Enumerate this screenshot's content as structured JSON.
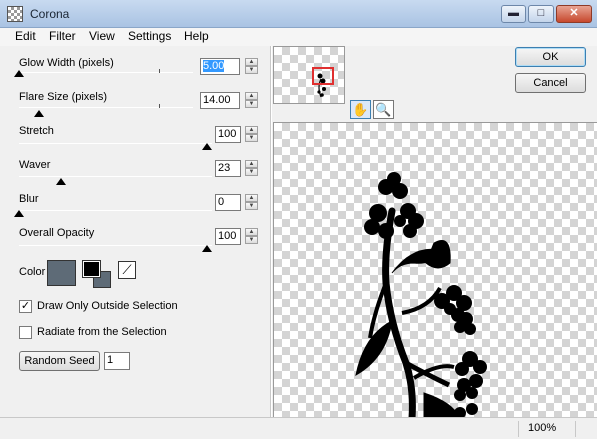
{
  "window": {
    "title": "Corona",
    "min_glyph": "▬",
    "max_glyph": "□",
    "close_glyph": "✕"
  },
  "menu": [
    "Edit",
    "Filter",
    "View",
    "Settings",
    "Help"
  ],
  "controls": {
    "glow_width": {
      "label": "Glow Width (pixels)",
      "value": "5.00",
      "level": 0.0
    },
    "flare_size": {
      "label": "Flare Size (pixels)",
      "value": "14.00",
      "level": 0.12
    },
    "stretch": {
      "label": "Stretch",
      "value": "100",
      "level": 1.0
    },
    "waver": {
      "label": "Waver",
      "value": "23",
      "level": 0.23
    },
    "blur": {
      "label": "Blur",
      "value": "0",
      "level": 0.0
    },
    "overall_opacity": {
      "label": "Overall Opacity",
      "value": "100",
      "level": 1.0
    }
  },
  "color": {
    "label": "Color",
    "swatch": "#5e6b77",
    "fg": "#000000",
    "bg": "#5e6b77"
  },
  "checkboxes": {
    "draw_only_outside": {
      "label": "Draw Only Outside Selection",
      "checked": true,
      "mark": "✓"
    },
    "radiate": {
      "label": "Radiate from the Selection",
      "checked": false,
      "mark": ""
    }
  },
  "random_seed": {
    "button": "Random Seed",
    "value": "1"
  },
  "buttons": {
    "ok": "OK",
    "cancel": "Cancel"
  },
  "tools": {
    "hand": "✋",
    "zoom": "🔍"
  },
  "status": {
    "zoom": "100%"
  }
}
